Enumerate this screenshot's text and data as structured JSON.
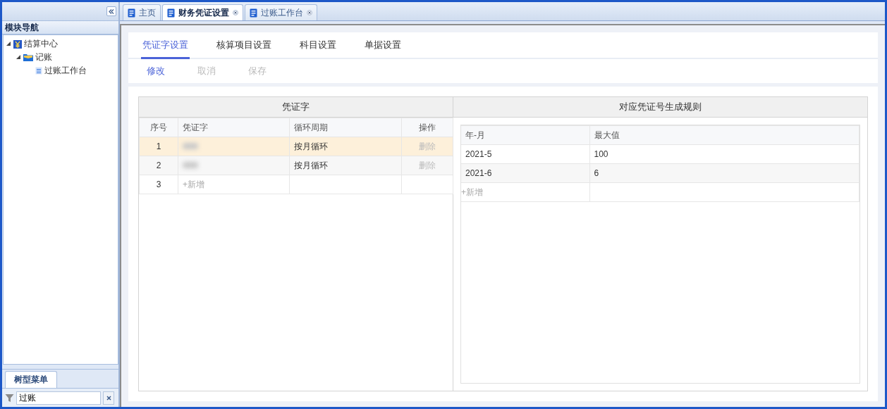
{
  "sidebar": {
    "title": "模块导航",
    "tree": [
      {
        "label": "结算中心",
        "kind": "module",
        "expanded": true,
        "children": [
          {
            "label": "记账",
            "kind": "folder",
            "expanded": true,
            "children": [
              {
                "label": "过账工作台",
                "kind": "page"
              }
            ]
          }
        ]
      }
    ],
    "bottom_tab": "树型菜单",
    "filter": {
      "value": "过账"
    }
  },
  "tabs": [
    {
      "label": "主页",
      "selected": false,
      "closable": false
    },
    {
      "label": "财务凭证设置",
      "selected": true,
      "closable": true
    },
    {
      "label": "过账工作台",
      "selected": false,
      "closable": true
    }
  ],
  "sub_tabs": [
    {
      "label": "凭证字设置",
      "selected": true
    },
    {
      "label": "核算项目设置",
      "selected": false
    },
    {
      "label": "科目设置",
      "selected": false
    },
    {
      "label": "单据设置",
      "selected": false
    }
  ],
  "toolbar": [
    {
      "label": "修改",
      "disabled": false
    },
    {
      "label": "取消",
      "disabled": true
    },
    {
      "label": "保存",
      "disabled": true
    }
  ],
  "voucher_table": {
    "title": "凭证字",
    "columns": [
      "序号",
      "凭证字",
      "循环周期",
      "操作"
    ],
    "rows": [
      {
        "index": "1",
        "cycle": "按月循环",
        "action": "删除",
        "action_disabled": true,
        "selected": true
      },
      {
        "index": "2",
        "cycle": "按月循环",
        "action": "删除",
        "action_disabled": true,
        "selected": false
      }
    ],
    "add_row": {
      "index": "3",
      "label": "+新增"
    }
  },
  "rule_table": {
    "title": "对应凭证号生成规则",
    "columns": [
      "年-月",
      "最大值"
    ],
    "rows": [
      {
        "month": "2021-5",
        "max": "100"
      },
      {
        "month": "2021-6",
        "max": "6"
      }
    ],
    "add_label": "+新增"
  }
}
